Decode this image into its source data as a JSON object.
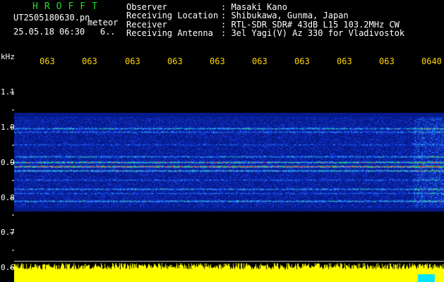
{
  "header": {
    "app_name": "HROFFT",
    "file_name": "UT2505180630.pn",
    "kind_label": "meteor",
    "date_time": "25.05.18 06:30",
    "date_suffix": "6..",
    "rows": [
      {
        "key": "Observer",
        "value": ": Masaki Kano"
      },
      {
        "key": "Receiving Location",
        "value": ": Shibukawa, Gunma, Japan"
      },
      {
        "key": "Receiver",
        "value": ": RTL-SDR SDR# 43dB L15 103.2MHz CW"
      },
      {
        "key": "Receiving Antenna",
        "value": ": 3el Yagi(V) Az 330 for Vladivostok"
      }
    ]
  },
  "axis": {
    "unit": "kHz",
    "y_ticks": [
      "1.1",
      "1.0",
      "0.9",
      "0.8",
      "0.7",
      "0.6"
    ],
    "x_ticks": [
      "063",
      "063",
      "063",
      "063",
      "063",
      "063",
      "063",
      "063",
      "063",
      "0640"
    ]
  },
  "colors": {
    "background": "#000000",
    "app_name": "#22dd22",
    "x_tick_text": "#ffd400",
    "noise_floor": "#061a8c",
    "histogram": "#ffff00",
    "echo_trace": "#ff3030"
  }
}
